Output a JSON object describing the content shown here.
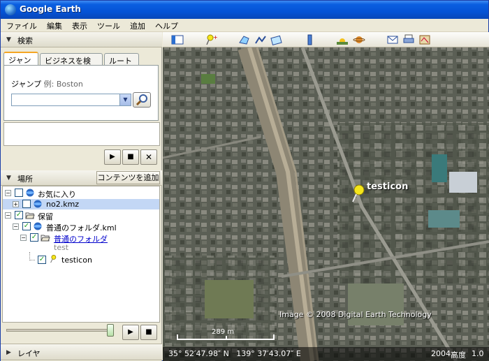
{
  "window": {
    "title": "Google Earth"
  },
  "menu": [
    "ファイル",
    "編集",
    "表示",
    "ツール",
    "追加",
    "ヘルプ"
  ],
  "search": {
    "section_title": "検索",
    "tabs": [
      "ジャンプ",
      "ビジネスを検索",
      "ルート"
    ],
    "field_label": "ジャンプ",
    "field_hint": "例: Boston",
    "input_value": ""
  },
  "places": {
    "section_title": "場所",
    "add_content_label": "コンテンツを追加",
    "tree": [
      {
        "label": "お気に入り"
      },
      {
        "label": "no2.kmz"
      },
      {
        "label": "保留"
      },
      {
        "label": "普通のフォルダ.kml"
      },
      {
        "label": "普通のフォルダ"
      },
      {
        "label": "test"
      },
      {
        "label": "testicon"
      }
    ]
  },
  "layers": {
    "section_title": "レイヤ"
  },
  "map": {
    "placemark_label": "testicon",
    "copyright": "Image © 2008 Digital Earth Technology",
    "scale_label": "289 m",
    "coordinates": "35° 52′47.98″ N   139° 37′43.07″ E",
    "imagery_date": "2004",
    "altitude_label": "高度",
    "altitude_value": "1.0"
  },
  "colors": {
    "titlebar": "#0553d6",
    "link": "#0000cc",
    "selection": "#c3d7f5",
    "placemark": "#f5e61b"
  }
}
